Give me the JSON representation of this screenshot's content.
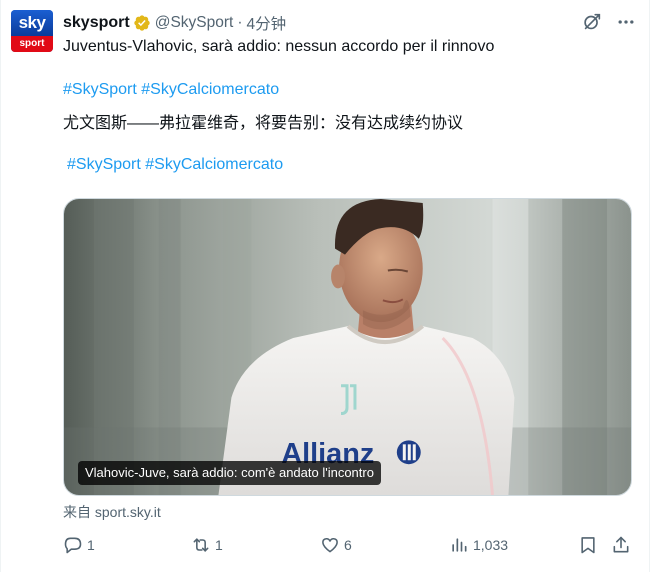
{
  "author": {
    "avatar_top": "sky",
    "avatar_bottom": "sport",
    "name": "skysport",
    "handle": "@SkySport",
    "separator": "·",
    "time": "4分钟",
    "verified_color": "#e2b719"
  },
  "tweet": {
    "text_italian": "Juventus-Vlahovic, sarà addio: nessun accordo per il rinnovo",
    "hashtags_1": "#SkySport #SkyCalciomercato",
    "text_chinese": "尤文图斯——弗拉霍维奇，将要告别：没有达成续约协议",
    "hashtags_2": "#SkySport #SkyCalciomercato"
  },
  "media": {
    "caption": "Vlahovic-Juve, sarà addio: com'è andato l'incontro",
    "shirt_sponsor": "Allianz"
  },
  "source": "来自 sport.sky.it",
  "actions": {
    "replies": "1",
    "retweets": "1",
    "likes": "6",
    "views": "1,033"
  },
  "colors": {
    "link": "#1d9bf0",
    "muted": "#536471",
    "text": "#0f1419"
  },
  "icons": [
    "grok-icon",
    "more-icon",
    "verified-badge-icon",
    "reply-icon",
    "retweet-icon",
    "like-icon",
    "views-icon",
    "bookmark-icon",
    "share-icon"
  ]
}
